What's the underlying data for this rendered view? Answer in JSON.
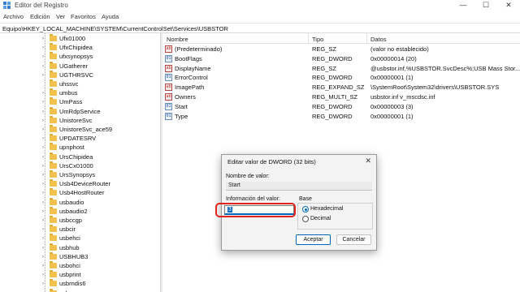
{
  "window": {
    "title": "Editor del Registro",
    "minimize": "—",
    "maximize": "☐",
    "close": "✕"
  },
  "menu": [
    "Archivo",
    "Edición",
    "Ver",
    "Favoritos",
    "Ayuda"
  ],
  "address": "Equipo\\HKEY_LOCAL_MACHINE\\SYSTEM\\CurrentControlSet\\Services\\USBSTOR",
  "tree": {
    "items": [
      {
        "label": "Ufx01000",
        "expandable": true
      },
      {
        "label": "UfxChipidea",
        "expandable": true
      },
      {
        "label": "ufxsynopsys",
        "expandable": true
      },
      {
        "label": "UGatherer",
        "expandable": true
      },
      {
        "label": "UGTHRSVC",
        "expandable": true
      },
      {
        "label": "uhssvc",
        "expandable": false
      },
      {
        "label": "umbus",
        "expandable": true
      },
      {
        "label": "UmPass",
        "expandable": true
      },
      {
        "label": "UmRdpService",
        "expandable": true
      },
      {
        "label": "UnistoreSvc",
        "expandable": true
      },
      {
        "label": "UnistoreSvc_ace59",
        "expandable": true
      },
      {
        "label": "UPDATESRV",
        "expandable": true
      },
      {
        "label": "upnphost",
        "expandable": true
      },
      {
        "label": "UrsChipidea",
        "expandable": true
      },
      {
        "label": "UrsCx01000",
        "expandable": true
      },
      {
        "label": "UrsSynopsys",
        "expandable": true
      },
      {
        "label": "Usb4DeviceRouter",
        "expandable": true
      },
      {
        "label": "Usb4HostRouter",
        "expandable": true
      },
      {
        "label": "usbaudio",
        "expandable": true
      },
      {
        "label": "usbaudio2",
        "expandable": true
      },
      {
        "label": "usbccgp",
        "expandable": true
      },
      {
        "label": "usbcir",
        "expandable": true
      },
      {
        "label": "usbehci",
        "expandable": true
      },
      {
        "label": "usbhub",
        "expandable": true
      },
      {
        "label": "USBHUB3",
        "expandable": true
      },
      {
        "label": "usbohci",
        "expandable": true
      },
      {
        "label": "usbprint",
        "expandable": true
      },
      {
        "label": "usbrndis6",
        "expandable": true
      },
      {
        "label": "usbser",
        "expandable": true
      }
    ]
  },
  "values_panel": {
    "headers": {
      "name": "Nombre",
      "type": "Tipo",
      "data": "Datos"
    },
    "rows": [
      {
        "name": "(Predeterminado)",
        "type": "REG_SZ",
        "data": "(valor no establecido)",
        "icon": "ab"
      },
      {
        "name": "BootFlags",
        "type": "REG_DWORD",
        "data": "0x00000014 (20)",
        "icon": "01"
      },
      {
        "name": "DisplayName",
        "type": "REG_SZ",
        "data": "@usbstor.inf,%USBSTOR.SvcDesc%;USB Mass Stor...",
        "icon": "ab"
      },
      {
        "name": "ErrorControl",
        "type": "REG_DWORD",
        "data": "0x00000001 (1)",
        "icon": "01"
      },
      {
        "name": "ImagePath",
        "type": "REG_EXPAND_SZ",
        "data": "\\SystemRoot\\System32\\drivers\\USBSTOR.SYS",
        "icon": "ab"
      },
      {
        "name": "Owners",
        "type": "REG_MULTI_SZ",
        "data": "usbstor.inf v_mscdsc.inf",
        "icon": "ab"
      },
      {
        "name": "Start",
        "type": "REG_DWORD",
        "data": "0x00000003 (3)",
        "icon": "01"
      },
      {
        "name": "Type",
        "type": "REG_DWORD",
        "data": "0x00000001 (1)",
        "icon": "01"
      }
    ]
  },
  "dialog": {
    "title": "Editar valor de DWORD (32 bits)",
    "close": "✕",
    "value_name_label": "Nombre de valor:",
    "value_name": "Start",
    "value_data_label": "Información del valor:",
    "value_data": "3",
    "base_label": "Base",
    "radio_hex": "Hexadecimal",
    "radio_dec": "Decimal",
    "selected_base": "Hexadecimal",
    "ok": "Aceptar",
    "cancel": "Cancelar"
  },
  "colors": {
    "accent": "#0067c0",
    "highlight": "#e0251f",
    "folder": "#f2c14e"
  }
}
